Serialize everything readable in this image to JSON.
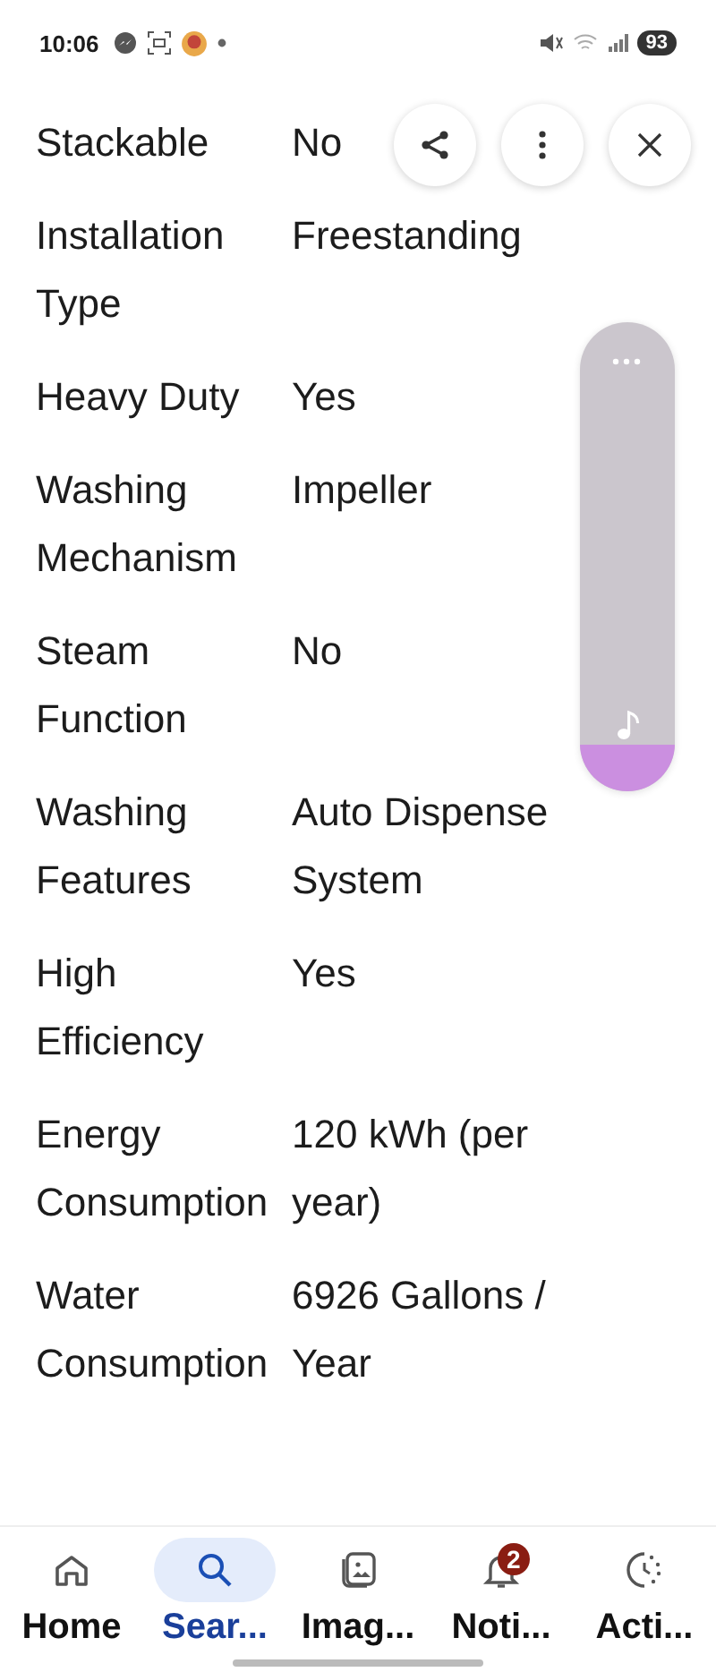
{
  "status_bar": {
    "time": "10:06",
    "battery": "93"
  },
  "specs": [
    {
      "label": "Stackable",
      "value": "No"
    },
    {
      "label": "Installation Type",
      "value": "Freestanding"
    },
    {
      "label": "Heavy Duty",
      "value": "Yes"
    },
    {
      "label": "Washing Mechanism",
      "value": "Impeller"
    },
    {
      "label": "Steam Function",
      "value": "No"
    },
    {
      "label": "Washing Features",
      "value": "Auto Dispense System"
    },
    {
      "label": "High Efficiency",
      "value": "Yes"
    },
    {
      "label": "Energy Consumption",
      "value": "120 kWh (per year)"
    },
    {
      "label": "Water Consumption",
      "value": "6926 Gallons / Year"
    }
  ],
  "volume_panel": {
    "level": 0.1
  },
  "nav": [
    {
      "kind": "home",
      "label": "Home",
      "selected": false
    },
    {
      "kind": "search",
      "label": "Sear...",
      "selected": true
    },
    {
      "kind": "images",
      "label": "Imag...",
      "selected": false
    },
    {
      "kind": "notifications",
      "label": "Noti...",
      "selected": false,
      "badge": "2"
    },
    {
      "kind": "activity",
      "label": "Acti...",
      "selected": false
    }
  ]
}
